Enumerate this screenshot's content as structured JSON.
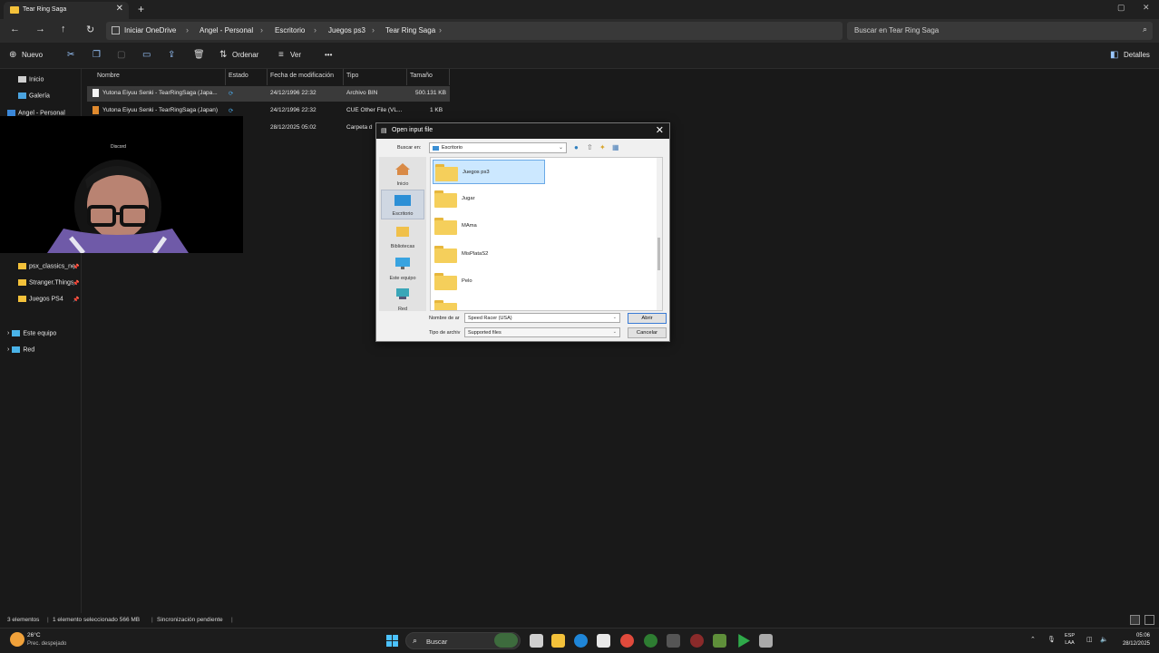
{
  "tab": {
    "title": "Tear Ring Saga",
    "close": "✕",
    "new": "+"
  },
  "window_controls": {
    "minimize": "—",
    "maximize": "▢"
  },
  "nav": {
    "back": "←",
    "forward": "→",
    "up": "↑",
    "refresh": "↻",
    "expand": "›"
  },
  "breadcrumb": [
    "Iniciar OneDrive",
    "Angel - Personal",
    "Escritorio",
    "Juegos ps3",
    "Tear Ring Saga"
  ],
  "search": {
    "placeholder": "Buscar en Tear Ring Saga",
    "icon": "⌕"
  },
  "commands": {
    "new": "Nuevo",
    "sort": "Ordenar",
    "view": "Ver",
    "more": "•••",
    "details": "Detalles"
  },
  "sidebar": {
    "home": "Inicio",
    "gallery": "Galería",
    "onedrive": "Angel - Personal",
    "pinned": [
      "psx_classics_ne",
      "Stranger.Things",
      "Juegos PS4"
    ],
    "this_pc": "Este equipo",
    "network": "Red"
  },
  "columns": {
    "name": "Nombre",
    "status": "Estado",
    "modified": "Fecha de modificación",
    "type": "Tipo",
    "size": "Tamaño"
  },
  "files": [
    {
      "name": "Yutona Eiyuu Senki - TearRingSaga (Japa...",
      "modified": "24/12/1996 22:32",
      "type": "Archivo BIN",
      "size": "500.131 KB"
    },
    {
      "name": "Yutona Eiyuu Senki - TearRingSaga (Japan)",
      "modified": "24/12/1996 22:32",
      "type": "CUE Other File (VL...",
      "size": "1 KB"
    },
    {
      "name": "",
      "modified": "28/12/2025 05:02",
      "type": "Carpeta d",
      "size": ""
    }
  ],
  "webcam": {
    "label": "Discord"
  },
  "dialog": {
    "title": "Open input file",
    "look_in_label": "Buscar en:",
    "look_in_value": "Escritorio",
    "places": [
      "Inicio",
      "Escritorio",
      "Bibliotecas",
      "Este equipo",
      "Red"
    ],
    "items": [
      "Juegos ps3",
      "Jugar",
      "MAma",
      "MisPlataS2",
      "Pelo"
    ],
    "filename_label": "Nombre de ar",
    "filename_value": "Speed Racer (USA)",
    "filetype_label": "Tipo de archiv",
    "filetype_value": "Supported files",
    "open": "Abrir",
    "cancel": "Cancelar"
  },
  "status": {
    "count": "3 elementos",
    "selected": "1 elemento seleccionado  566 MB",
    "sync": "Sincronización pendiente"
  },
  "taskbar": {
    "temp": "26°C",
    "weather": "Prec. despejado",
    "search": "Buscar",
    "lang_1": "ESP",
    "lang_2": "LAA",
    "time": "05:06",
    "date": "28/12/2025"
  }
}
